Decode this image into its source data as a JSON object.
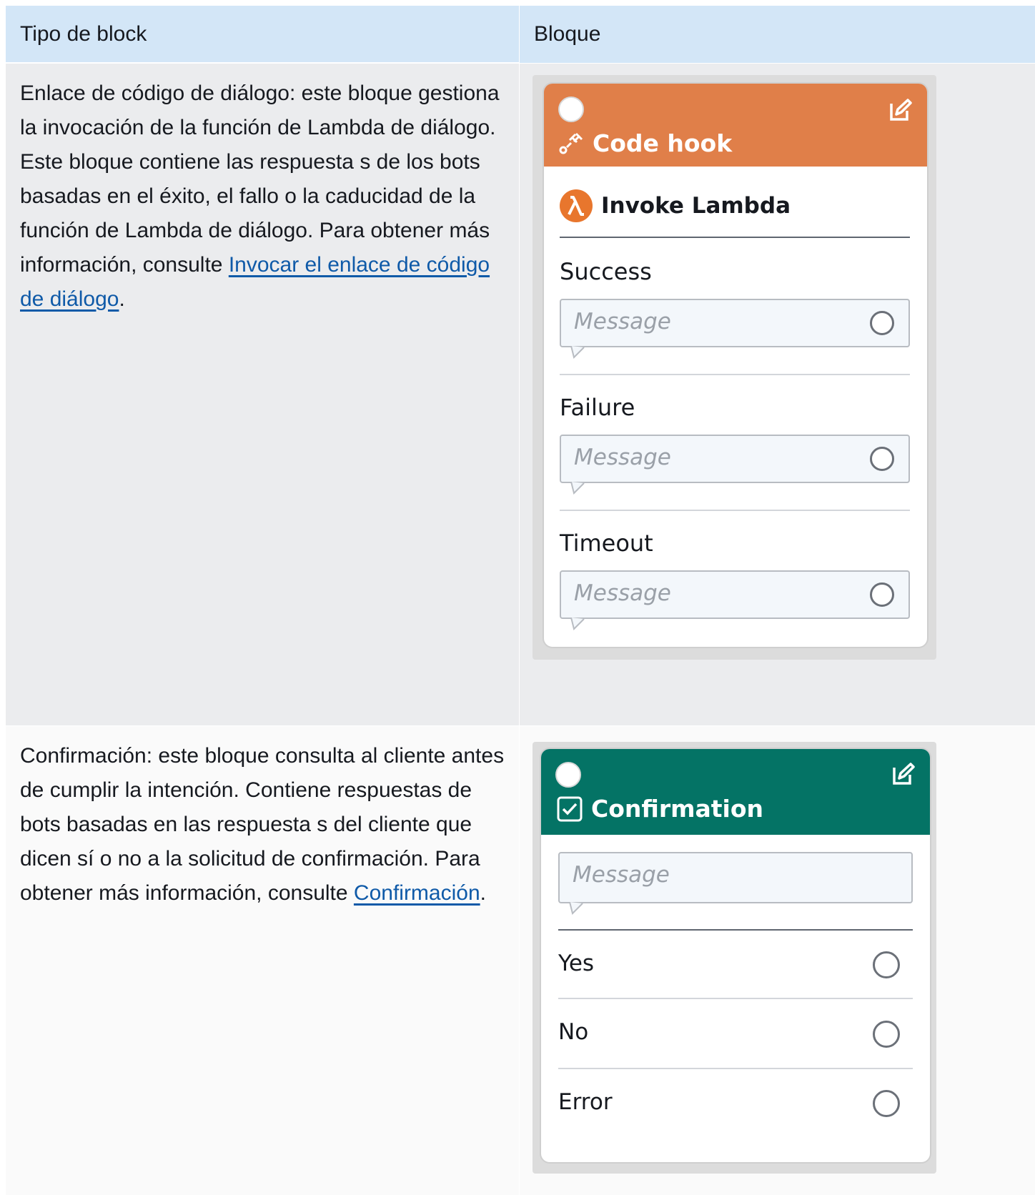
{
  "header": {
    "col1": "Tipo de block",
    "col2": "Bloque"
  },
  "rows": [
    {
      "description": "Enlace de código de diálogo: este bloque gestiona la invocación de la función de Lambda de diálogo. Este bloque contiene las respuesta s de los bots basadas en el éxito, el fallo o la caducidad de la función de Lambda de diálogo. Para obtener más información, consulte ",
      "link_text": "Invocar el enlace de código de diálogo",
      "after_link": ".",
      "block": {
        "title": "Code hook",
        "header_color": "#e07f49",
        "icon": "code-hook-icon",
        "action_title": "Invoke Lambda",
        "action_icon": "lambda-icon",
        "sections": [
          {
            "label": "Success",
            "placeholder": "Message"
          },
          {
            "label": "Failure",
            "placeholder": "Message"
          },
          {
            "label": "Timeout",
            "placeholder": "Message"
          }
        ]
      }
    },
    {
      "description": "Confirmación: este bloque consulta al cliente antes de cumplir la intención. Contiene respuestas de bots basadas en las respuesta s del cliente que dicen sí o no a la solicitud de confirmación. Para obtener más información, consulte ",
      "link_text": "Confirmación",
      "after_link": ".",
      "block": {
        "title": "Confirmation",
        "header_color": "#047365",
        "icon": "checkbox-icon",
        "placeholder": "Message",
        "options": [
          "Yes",
          "No",
          "Error"
        ]
      }
    }
  ]
}
